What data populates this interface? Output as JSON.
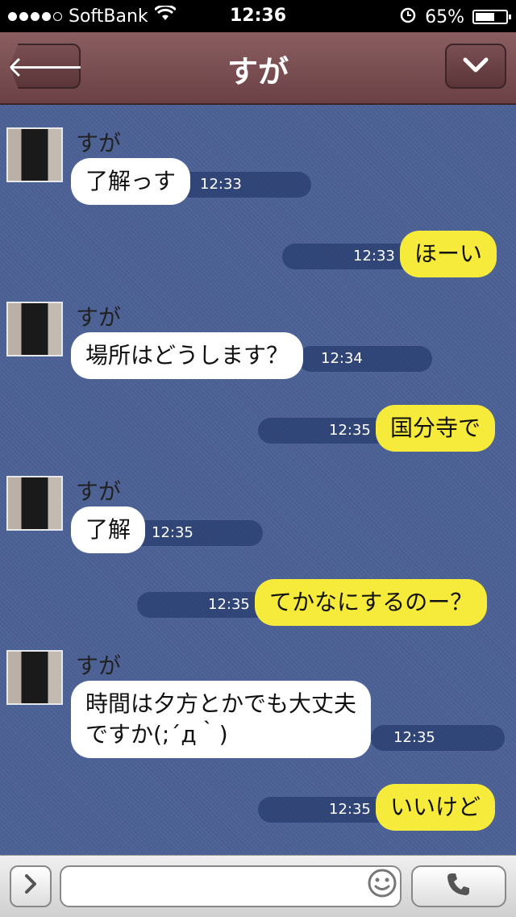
{
  "status_bar": {
    "carrier": "SoftBank",
    "time": "12:36",
    "battery": "65%",
    "battery_level": 0.65
  },
  "header": {
    "title": "すが"
  },
  "messages": [
    {
      "direction": "in",
      "sender": "すが",
      "text": "了解っす",
      "time": "12:33"
    },
    {
      "direction": "out",
      "text": "ほーい",
      "time": "12:33"
    },
    {
      "direction": "in",
      "sender": "すが",
      "text": "場所はどうします？",
      "time": "12:34"
    },
    {
      "direction": "out",
      "text": "国分寺で",
      "time": "12:35"
    },
    {
      "direction": "in",
      "sender": "すが",
      "text": "了解",
      "time": "12:35"
    },
    {
      "direction": "out",
      "text": "てかなにするのー？",
      "time": "12:35"
    },
    {
      "direction": "in",
      "sender": "すが",
      "text": "時間は夕方とかでも大丈夫\nですか(;´д｀)",
      "time": "12:35"
    },
    {
      "direction": "out",
      "text": "いいけど",
      "time": "12:35"
    }
  ],
  "input": {
    "placeholder": ""
  },
  "icons": {
    "back": "arrow-left-icon",
    "menu": "chevron-down-icon",
    "expand": "chevron-right-icon",
    "emoji": "smiley-icon",
    "call": "phone-icon"
  }
}
